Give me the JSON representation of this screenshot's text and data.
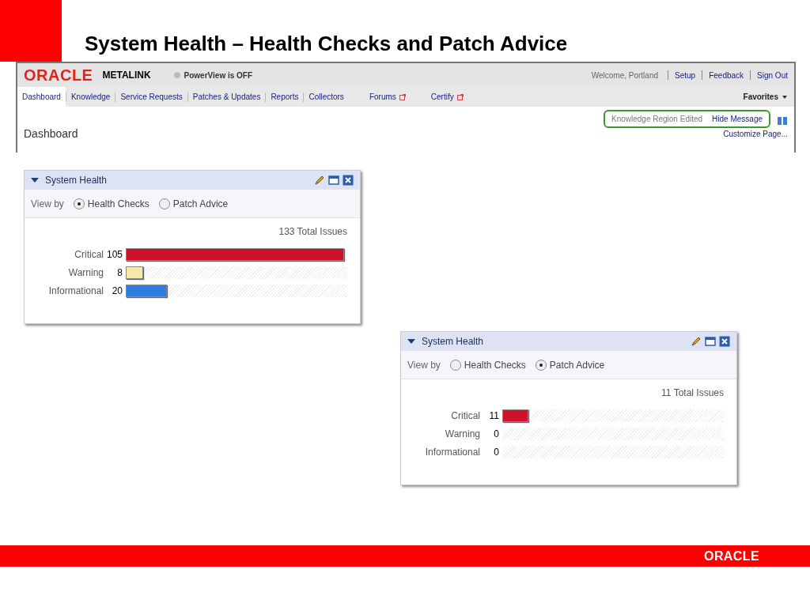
{
  "slide_title": "System Health – Health Checks and Patch Advice",
  "header": {
    "logo": "ORACLE",
    "product": "METALINK",
    "powerview": "PowerView is OFF",
    "welcome": "Welcome,  Portland",
    "links": [
      "Setup",
      "Feedback",
      "Sign Out"
    ]
  },
  "tabs": [
    {
      "label": "Dashboard",
      "selected": true,
      "external": false
    },
    {
      "label": "Knowledge",
      "selected": false,
      "external": false
    },
    {
      "label": "Service Requests",
      "selected": false,
      "external": false
    },
    {
      "label": "Patches & Updates",
      "selected": false,
      "external": false
    },
    {
      "label": "Reports",
      "selected": false,
      "external": false
    },
    {
      "label": "Collectors",
      "selected": false,
      "external": false
    },
    {
      "label": "Forums",
      "selected": false,
      "external": true
    },
    {
      "label": "Certify",
      "selected": false,
      "external": true
    }
  ],
  "favorites": "Favorites",
  "page_title": "Dashboard",
  "message": {
    "text": "Knowledge Region Edited",
    "action": "Hide Message"
  },
  "customize": "Customize Page...",
  "panels": [
    {
      "title": "System Health",
      "view_by": "View by",
      "options": [
        {
          "label": "Health Checks",
          "selected": true
        },
        {
          "label": "Patch Advice",
          "selected": false
        }
      ],
      "total": "133  Total Issues",
      "rows": [
        {
          "label": "Critical",
          "count": "105",
          "level": 1.0,
          "color": "#d0112b"
        },
        {
          "label": "Warning",
          "count": "8",
          "level": 0.08,
          "color": "#f6e9a8"
        },
        {
          "label": "Informational",
          "count": "20",
          "level": 0.19,
          "color": "#2b7de0"
        }
      ]
    },
    {
      "title": "System Health",
      "view_by": "View by",
      "options": [
        {
          "label": "Health Checks",
          "selected": false
        },
        {
          "label": "Patch Advice",
          "selected": true
        }
      ],
      "total": "11  Total Issues",
      "rows": [
        {
          "label": "Critical",
          "count": "11",
          "level": 0.12,
          "color": "#d0112b"
        },
        {
          "label": "Warning",
          "count": "0",
          "level": 0
        },
        {
          "label": "Informational",
          "count": "0",
          "level": 0
        }
      ]
    }
  ],
  "footer_logo": "ORACLE"
}
